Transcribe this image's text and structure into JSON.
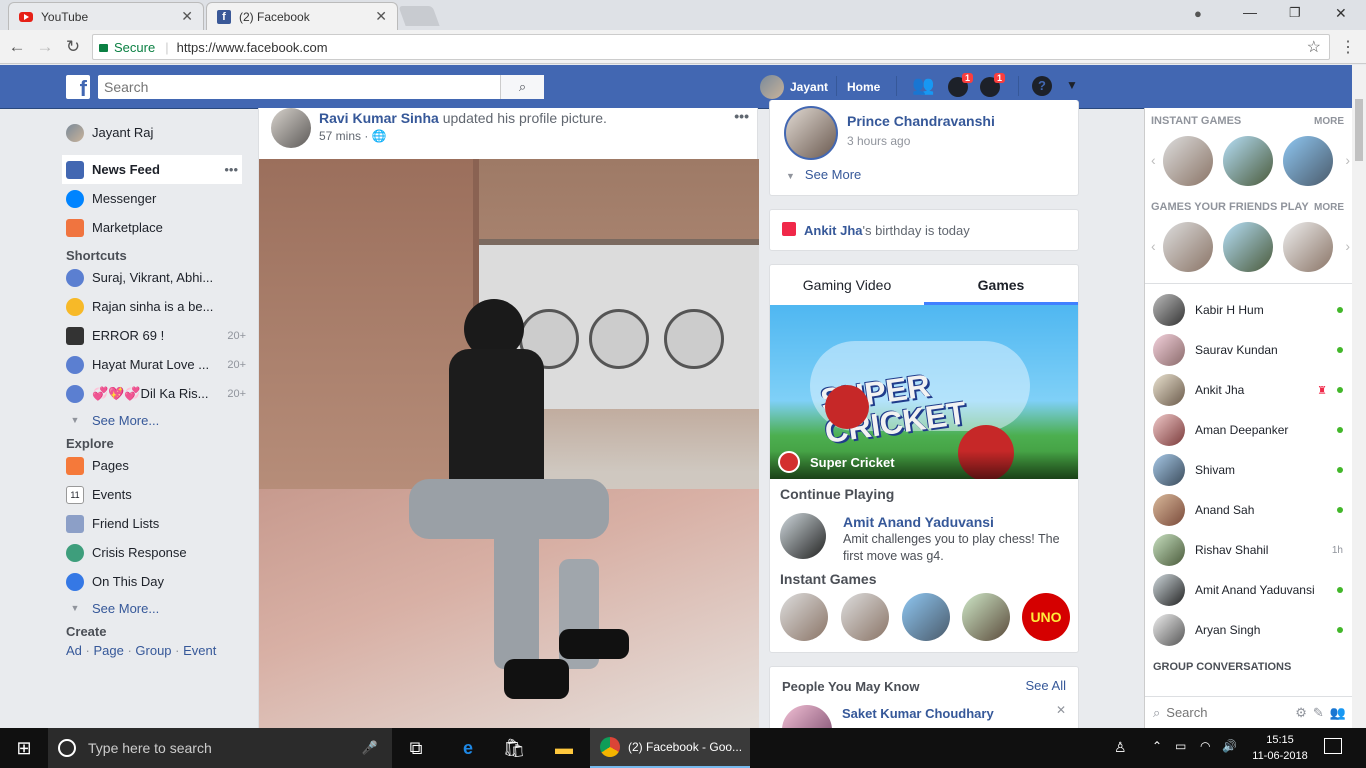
{
  "browser": {
    "tabs": [
      {
        "title": "YouTube",
        "active": false
      },
      {
        "title": "(2) Facebook",
        "active": true
      }
    ],
    "secure_label": "Secure",
    "url": "https://www.facebook.com"
  },
  "header": {
    "search_placeholder": "Search",
    "user_name": "Jayant",
    "home_label": "Home",
    "messages_badge": "1",
    "notifications_badge": "1",
    "brand_color": "#4267b2"
  },
  "left_nav": {
    "profile_name": "Jayant Raj",
    "main": [
      {
        "label": "News Feed",
        "icon": "news-feed-icon"
      },
      {
        "label": "Messenger",
        "icon": "messenger-icon"
      },
      {
        "label": "Marketplace",
        "icon": "marketplace-icon"
      }
    ],
    "shortcuts_title": "Shortcuts",
    "shortcuts": [
      {
        "label": "Suraj, Vikrant, Abhi...",
        "count": ""
      },
      {
        "label": "Rajan sinha is a be...",
        "count": ""
      },
      {
        "label": "ERROR 69 !",
        "count": "20+"
      },
      {
        "label": "Hayat Murat Love ...",
        "count": "20+"
      },
      {
        "label": "💞💖💞Dil Ka Ris...",
        "count": "20+"
      }
    ],
    "see_more": "See More...",
    "explore_title": "Explore",
    "explore": [
      {
        "label": "Pages",
        "icon": "pages-icon"
      },
      {
        "label": "Events",
        "icon": "events-icon"
      },
      {
        "label": "Friend Lists",
        "icon": "friend-lists-icon"
      },
      {
        "label": "Crisis Response",
        "icon": "crisis-response-icon"
      },
      {
        "label": "On This Day",
        "icon": "on-this-day-icon"
      }
    ],
    "see_more_2": "See More...",
    "create_title": "Create",
    "create_links": [
      "Ad",
      "Page",
      "Group",
      "Event"
    ]
  },
  "post": {
    "author": "Ravi Kumar Sinha",
    "action": " updated his profile picture.",
    "time": "57 mins",
    "options": "•••"
  },
  "right_col": {
    "friend_name": "Prince Chandravanshi",
    "friend_time": "3 hours ago",
    "see_more": "See More",
    "birthday_name": "Ankit Jha",
    "birthday_text": "'s birthday is today",
    "tabs": [
      "Gaming Video",
      "Games"
    ],
    "game_banner": "Super Cricket",
    "game_banner_art": "SUPER CRICKET",
    "continue_title": "Continue Playing",
    "challenge_name": "Amit Anand Yaduvansi",
    "challenge_text": "Amit challenges you to play chess! The first move was g4.",
    "instant_games_title": "Instant Games",
    "uno_label": "UNO",
    "pymk_title": "People You May Know",
    "see_all": "See All",
    "pymk_name": "Saket Kumar Choudhary"
  },
  "chat": {
    "instant_games": "INSTANT GAMES",
    "more": "MORE",
    "friends_play": "GAMES YOUR FRIENDS PLAY",
    "more2": "MORE",
    "contacts": [
      {
        "name": "Kabir H Hum",
        "status": "online"
      },
      {
        "name": "Saurav Kundan",
        "status": "online"
      },
      {
        "name": "Ankit Jha",
        "status": "online"
      },
      {
        "name": "Aman Deepanker",
        "status": "online"
      },
      {
        "name": "Shivam",
        "status": "online"
      },
      {
        "name": "Anand Sah",
        "status": "online"
      },
      {
        "name": "Rishav Shahil",
        "status": "1h"
      },
      {
        "name": "Amit Anand Yaduvansi",
        "status": "online"
      },
      {
        "name": "Aryan Singh",
        "status": "online"
      }
    ],
    "group_title": "GROUP CONVERSATIONS",
    "search_placeholder": "Search"
  },
  "taskbar": {
    "search_placeholder": "Type here to search",
    "chrome_window": "(2) Facebook - Goo...",
    "time": "15:15",
    "date": "11-06-2018"
  }
}
